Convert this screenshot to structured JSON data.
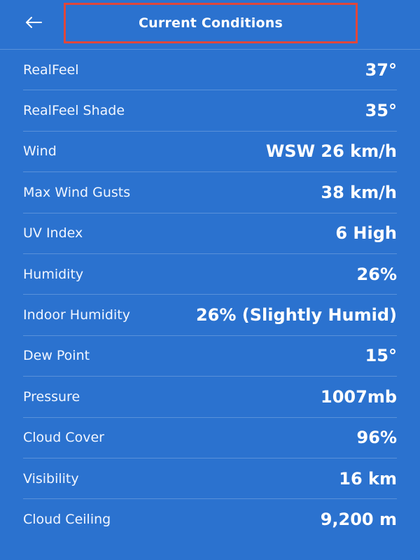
{
  "header": {
    "title": "Current Conditions",
    "back_icon": "arrow-left-icon"
  },
  "colors": {
    "background": "#2b72cf",
    "highlight_box": "#e0473b"
  },
  "conditions": [
    {
      "label": "RealFeel",
      "value": "37°"
    },
    {
      "label": "RealFeel Shade",
      "value": "35°"
    },
    {
      "label": "Wind",
      "value": "WSW 26 km/h"
    },
    {
      "label": "Max Wind Gusts",
      "value": "38 km/h"
    },
    {
      "label": "UV Index",
      "value": "6 High"
    },
    {
      "label": "Humidity",
      "value": "26%"
    },
    {
      "label": "Indoor Humidity",
      "value": "26% (Slightly Humid)"
    },
    {
      "label": "Dew Point",
      "value": "15°"
    },
    {
      "label": "Pressure",
      "value": "1007mb"
    },
    {
      "label": "Cloud Cover",
      "value": "96%"
    },
    {
      "label": "Visibility",
      "value": "16 km"
    },
    {
      "label": "Cloud Ceiling",
      "value": "9,200 m"
    }
  ]
}
